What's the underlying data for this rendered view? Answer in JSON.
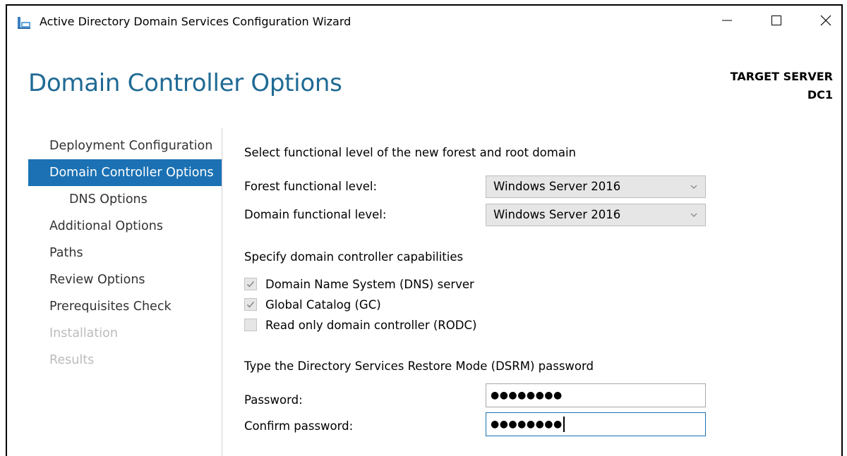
{
  "window": {
    "title": "Active Directory Domain Services Configuration Wizard",
    "app_icon": "ad-ds-wizard-icon",
    "controls": [
      "minimize-icon",
      "maximize-icon",
      "close-icon"
    ]
  },
  "header": {
    "page_title": "Domain Controller Options",
    "target_label": "TARGET SERVER",
    "target_value": "DC1"
  },
  "nav": {
    "items": [
      {
        "label": "Deployment Configuration",
        "state": "normal"
      },
      {
        "label": "Domain Controller Options",
        "state": "active"
      },
      {
        "label": "DNS Options",
        "state": "sub"
      },
      {
        "label": "Additional Options",
        "state": "normal"
      },
      {
        "label": "Paths",
        "state": "normal"
      },
      {
        "label": "Review Options",
        "state": "normal"
      },
      {
        "label": "Prerequisites Check",
        "state": "normal"
      },
      {
        "label": "Installation",
        "state": "disabled"
      },
      {
        "label": "Results",
        "state": "disabled"
      }
    ]
  },
  "functional_level": {
    "section_label": "Select functional level of the new forest and root domain",
    "forest_label": "Forest functional level:",
    "forest_value": "Windows Server 2016",
    "domain_label": "Domain functional level:",
    "domain_value": "Windows Server 2016"
  },
  "capabilities": {
    "section_label": "Specify domain controller capabilities",
    "options": [
      {
        "label": "Domain Name System (DNS) server",
        "checked": true
      },
      {
        "label": "Global Catalog (GC)",
        "checked": true
      },
      {
        "label": "Read only domain controller (RODC)",
        "checked": false
      }
    ]
  },
  "dsrm": {
    "section_label": "Type the Directory Services Restore Mode (DSRM) password",
    "password_label": "Password:",
    "password_value": "●●●●●●●●",
    "confirm_label": "Confirm password:",
    "confirm_value": "●●●●●●●●"
  },
  "colors": {
    "accent": "#1b71b3",
    "title_blue": "#1f6a94",
    "disabled_text": "#bcbcbc"
  }
}
